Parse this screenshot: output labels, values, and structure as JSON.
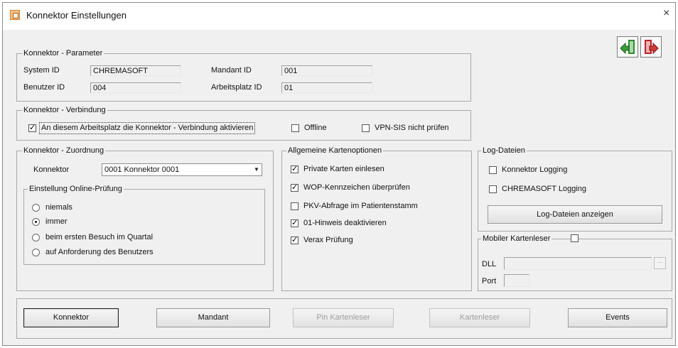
{
  "window": {
    "title": "Konnektor Einstellungen"
  },
  "parameter": {
    "group_label": "Konnektor - Parameter",
    "system_id_label": "System ID",
    "system_id_value": "CHREMASOFT",
    "benutzer_id_label": "Benutzer ID",
    "benutzer_id_value": "004",
    "mandant_id_label": "Mandant ID",
    "mandant_id_value": "001",
    "arbeitsplatz_id_label": "Arbeitsplatz ID",
    "arbeitsplatz_id_value": "01"
  },
  "verbindung": {
    "group_label": "Konnektor - Verbindung",
    "aktivieren_label": "An diesem Arbeitsplatz die Konnektor - Verbindung aktivieren",
    "aktivieren_checked": true,
    "offline_label": "Offline",
    "offline_checked": false,
    "vpn_label": "VPN-SIS nicht prüfen",
    "vpn_checked": false
  },
  "zuordnung": {
    "group_label": "Konnektor - Zuordnung",
    "konnektor_label": "Konnektor",
    "konnektor_value": "0001 Konnektor 0001",
    "online_group_label": "Einstellung Online-Prüfung",
    "options": [
      {
        "label": "niemals",
        "selected": false
      },
      {
        "label": "immer",
        "selected": true
      },
      {
        "label": "beim ersten Besuch im Quartal",
        "selected": false
      },
      {
        "label": "auf Anforderung des Benutzers",
        "selected": false
      }
    ]
  },
  "kartenoptionen": {
    "group_label": "Allgemeine Kartenoptionen",
    "items": [
      {
        "label": "Private Karten einlesen",
        "checked": true
      },
      {
        "label": "WOP-Kennzeichen überprüfen",
        "checked": true
      },
      {
        "label": "PKV-Abfrage im Patientenstamm",
        "checked": false
      },
      {
        "label": "01-Hinweis deaktivieren",
        "checked": true
      },
      {
        "label": "Verax Prüfung",
        "checked": true
      }
    ]
  },
  "log": {
    "group_label": "Log-Dateien",
    "konnektor_logging_label": "Konnektor Logging",
    "konnektor_logging_checked": false,
    "chremasoft_logging_label": "CHREMASOFT Logging",
    "chremasoft_logging_checked": false,
    "anzeigen_button": "Log-Dateien anzeigen"
  },
  "mobil": {
    "group_label": "Mobiler Kartenleser",
    "checked": false,
    "dll_label": "DLL",
    "dll_value": "",
    "browse_label": "...",
    "port_label": "Port",
    "port_value": ""
  },
  "buttons": {
    "konnektor": "Konnektor",
    "mandant": "Mandant",
    "pin_kartenleser": "Pin Kartenleser",
    "kartenleser": "Kartenleser",
    "events": "Events"
  },
  "colors": {
    "dialog_bg": "#f0f0f0",
    "green_icon": "#3b9e3b",
    "red_icon": "#c0262c"
  }
}
